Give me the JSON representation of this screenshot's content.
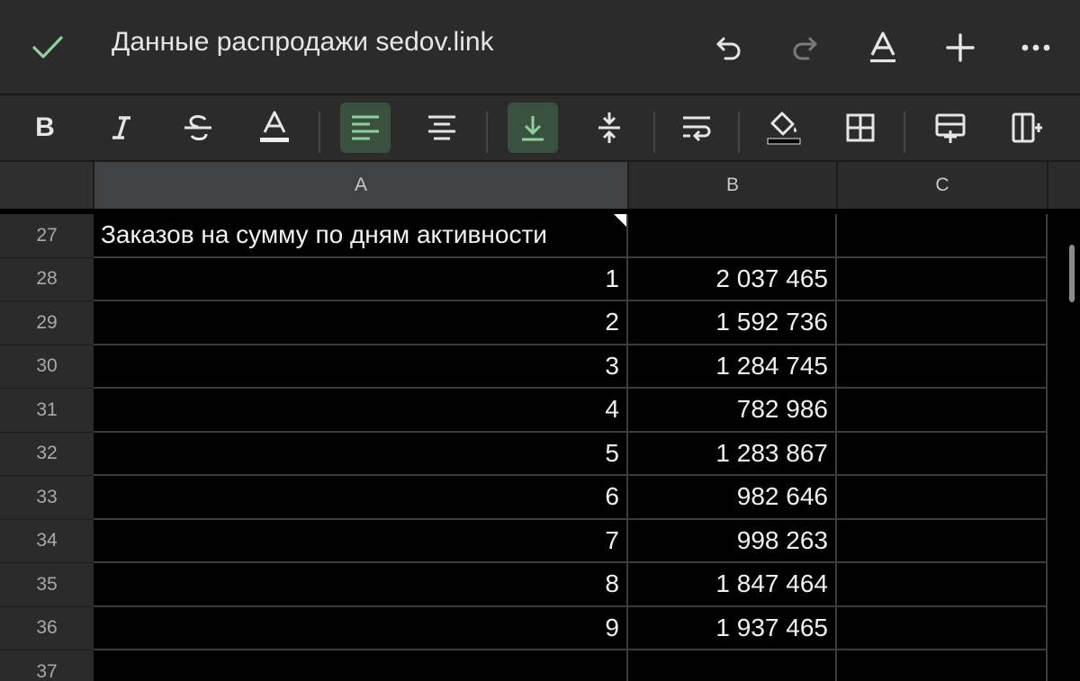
{
  "header": {
    "title": "Данные распродажи sedov.link"
  },
  "toolbar": {
    "bold_label": "B"
  },
  "columns": [
    "A",
    "B",
    "C"
  ],
  "rows": [
    {
      "num": "27",
      "a": "Заказов на сумму по дням активности",
      "b": "",
      "c": ""
    },
    {
      "num": "28",
      "a": "1",
      "b": "2 037 465",
      "c": ""
    },
    {
      "num": "29",
      "a": "2",
      "b": "1 592 736",
      "c": ""
    },
    {
      "num": "30",
      "a": "3",
      "b": "1 284 745",
      "c": ""
    },
    {
      "num": "31",
      "a": "4",
      "b": "782 986",
      "c": ""
    },
    {
      "num": "32",
      "a": "5",
      "b": "1 283 867",
      "c": ""
    },
    {
      "num": "33",
      "a": "6",
      "b": "982 646",
      "c": ""
    },
    {
      "num": "34",
      "a": "7",
      "b": "998 263",
      "c": ""
    },
    {
      "num": "35",
      "a": "8",
      "b": "1 847 464",
      "c": ""
    },
    {
      "num": "36",
      "a": "9",
      "b": "1 937 465",
      "c": ""
    },
    {
      "num": "37",
      "a": "",
      "b": "",
      "c": ""
    }
  ],
  "colors": {
    "accent_green": "#8fd19e",
    "active_bg": "#3b5140",
    "toolbar_bg": "#2b2b2c"
  }
}
